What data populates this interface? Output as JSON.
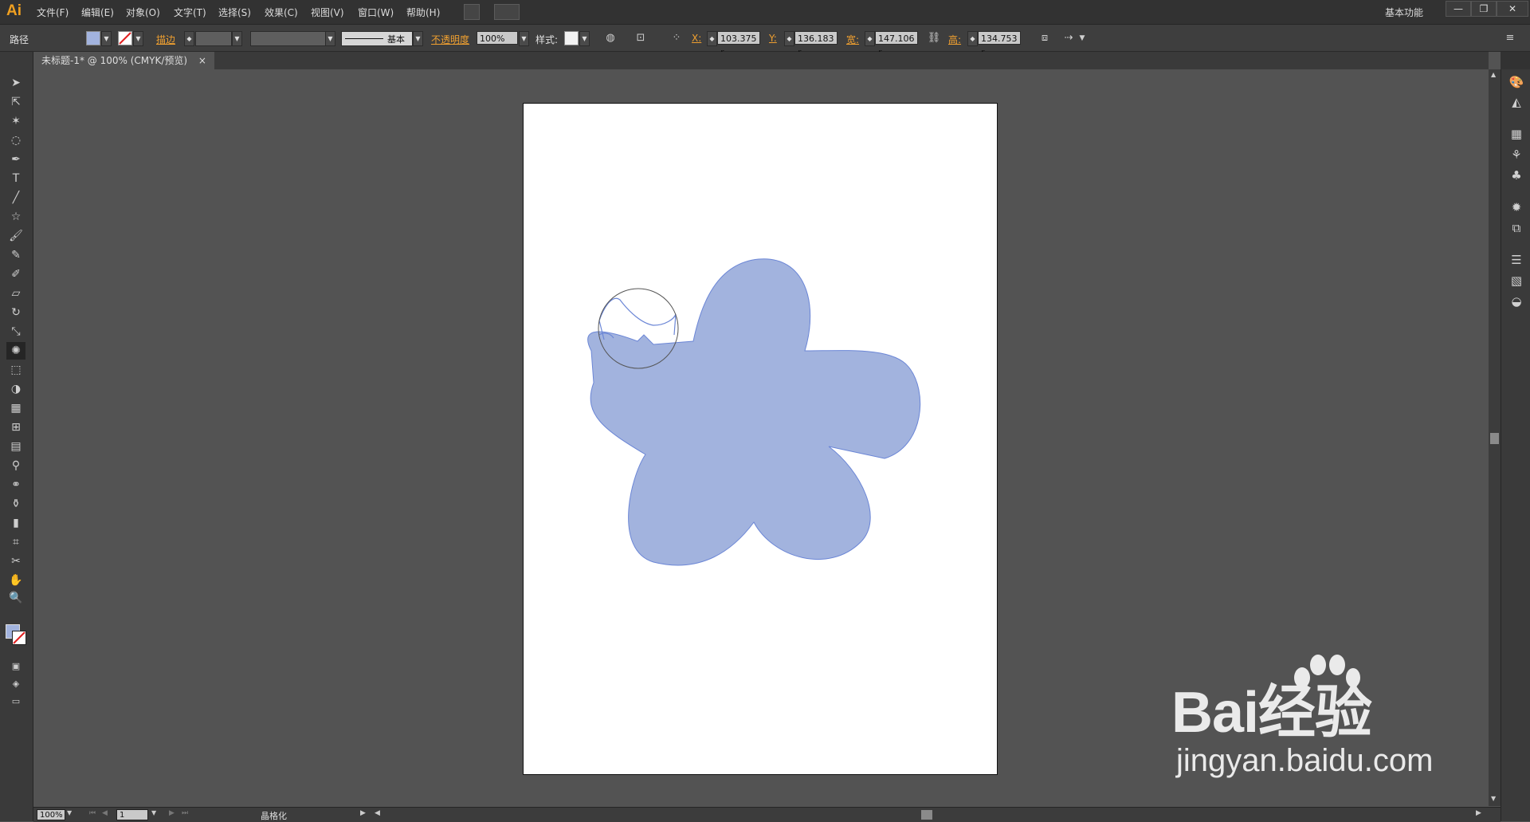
{
  "app": {
    "logo": "Ai",
    "workspace": "基本功能"
  },
  "menu": [
    {
      "label": "文件(F)"
    },
    {
      "label": "编辑(E)"
    },
    {
      "label": "对象(O)"
    },
    {
      "label": "文字(T)"
    },
    {
      "label": "选择(S)"
    },
    {
      "label": "效果(C)"
    },
    {
      "label": "视图(V)"
    },
    {
      "label": "窗口(W)"
    },
    {
      "label": "帮助(H)"
    }
  ],
  "window_controls": {
    "minimize": "—",
    "restore": "❐",
    "close": "✕"
  },
  "control_bar": {
    "selection_type": "路径",
    "stroke_label": "描边",
    "brush_style": "基本",
    "opacity_label": "不透明度",
    "opacity_value": "100%",
    "style_label": "样式:",
    "x_label": "X:",
    "x_value": "103.375 r",
    "y_label": "Y:",
    "y_value": "136.183 r",
    "w_label": "宽:",
    "w_value": "147.106 r",
    "h_label": "高:",
    "h_value": "134.753 r",
    "colors": {
      "fill": "#a2b3de",
      "label_accent": "#f0a030"
    }
  },
  "document_tab": {
    "title": "未标题-1* @ 100% (CMYK/预览)",
    "close": "×"
  },
  "status_bar": {
    "zoom": "100%",
    "artboard": "1",
    "tool_name": "晶格化"
  },
  "canvas": {
    "shape_fill": "#a2b3de",
    "shape_stroke": "#6b86d6",
    "brush_cursor": "circle-brush-cursor"
  },
  "watermark": {
    "brand": "Bai经验",
    "url": "jingyan.baidu.com"
  }
}
